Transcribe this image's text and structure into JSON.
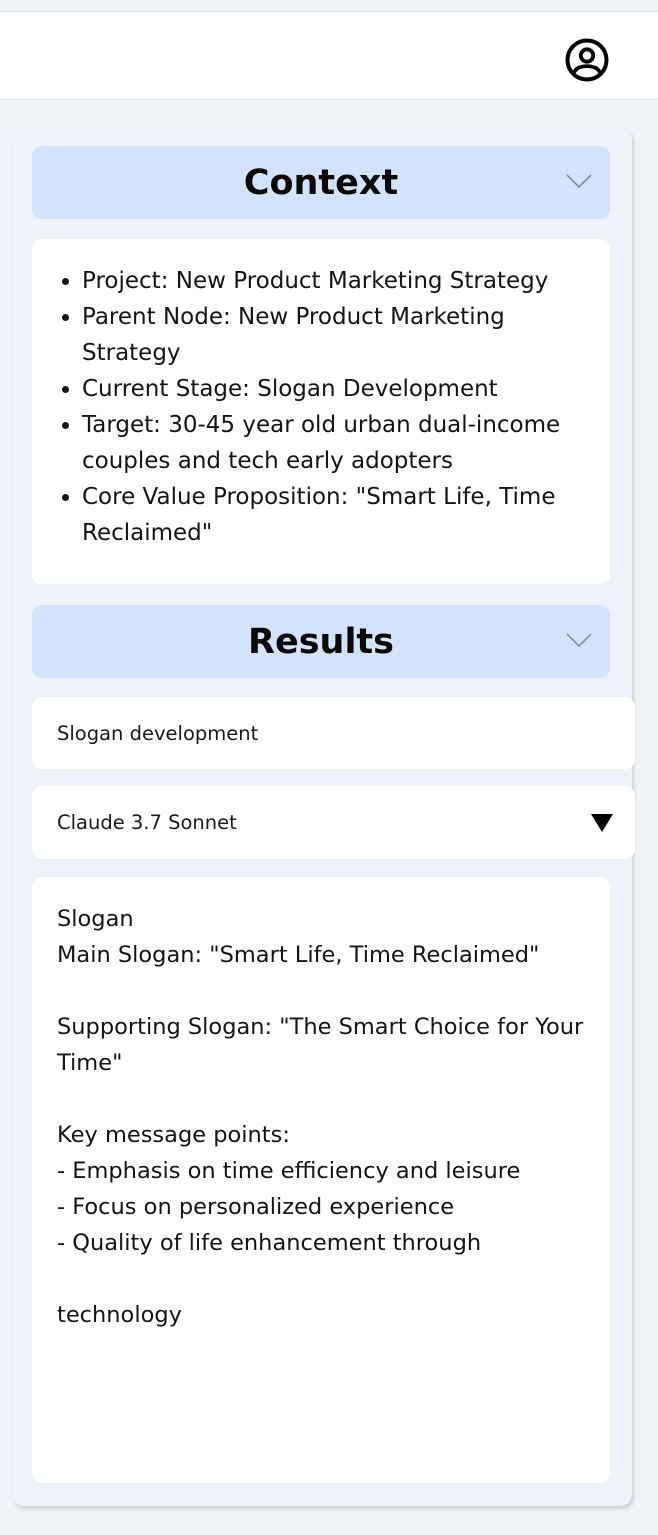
{
  "header": {
    "account_icon": "user-circle-icon"
  },
  "context": {
    "title": "Context",
    "chevron_icon": "chevron-down-icon",
    "items": [
      "Project: New Product Marketing Strategy",
      "Parent Node: New Product Marketing Strategy",
      "Current Stage: Slogan Development",
      "Target: 30-45 year old urban dual-income couples and tech early adopters",
      "Core Value Proposition: \"Smart Life, Time Reclaimed\""
    ]
  },
  "results": {
    "title": "Results",
    "chevron_icon": "chevron-down-icon",
    "topic_value": "Slogan development",
    "model": {
      "selected": "Claude 3.7 Sonnet",
      "caret_icon": "triangle-down-icon"
    },
    "output": "Slogan\nMain Slogan: \"Smart Life, Time Reclaimed\"\n\nSupporting Slogan: \"The Smart Choice for Your Time\"\n\nKey message points:\n- Emphasis on time efficiency and leisure\n- Focus on personalized experience\n- Quality of life enhancement through\n\ntechnology"
  },
  "colors": {
    "section_header_bg": "#d3e3fc",
    "panel_bg": "#eef3f9",
    "card_bg": "#ffffff"
  }
}
